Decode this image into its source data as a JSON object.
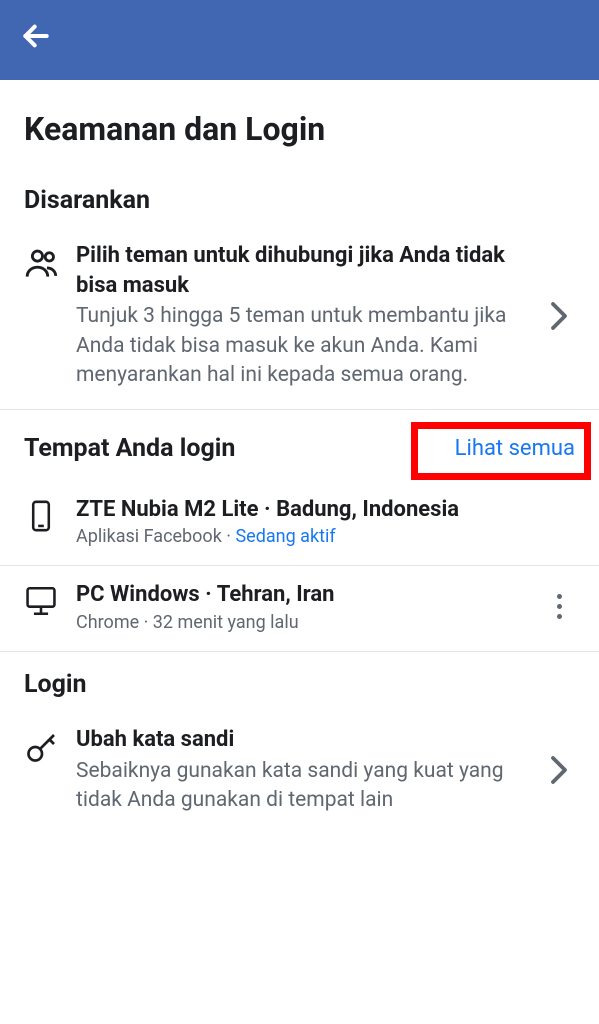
{
  "header": {
    "back_icon": "arrow-left"
  },
  "page_title": "Keamanan dan Login",
  "sections": {
    "recommended": {
      "title": "Disarankan",
      "item": {
        "title": "Pilih teman untuk dihubungi jika Anda tidak bisa masuk",
        "subtitle": "Tunjuk 3 hingga 5 teman untuk membantu jika Anda tidak bisa masuk ke akun Anda. Kami menyarankan hal ini kepada semua orang."
      }
    },
    "where_logged_in": {
      "title": "Tempat Anda login",
      "see_all": "Lihat semua",
      "devices": [
        {
          "title": "ZTE Nubia M2 Lite · Badung, Indonesia",
          "app": "Aplikasi Facebook",
          "sep": " · ",
          "status": "Sedang aktif",
          "icon": "mobile"
        },
        {
          "title": "PC Windows · Tehran, Iran",
          "app": "Chrome",
          "sep": " · ",
          "status": "32 menit yang lalu",
          "icon": "desktop"
        }
      ]
    },
    "login": {
      "title": "Login",
      "item": {
        "title": "Ubah kata sandi",
        "subtitle": "Sebaiknya gunakan kata sandi yang kuat yang tidak Anda gunakan di tempat lain"
      }
    }
  }
}
